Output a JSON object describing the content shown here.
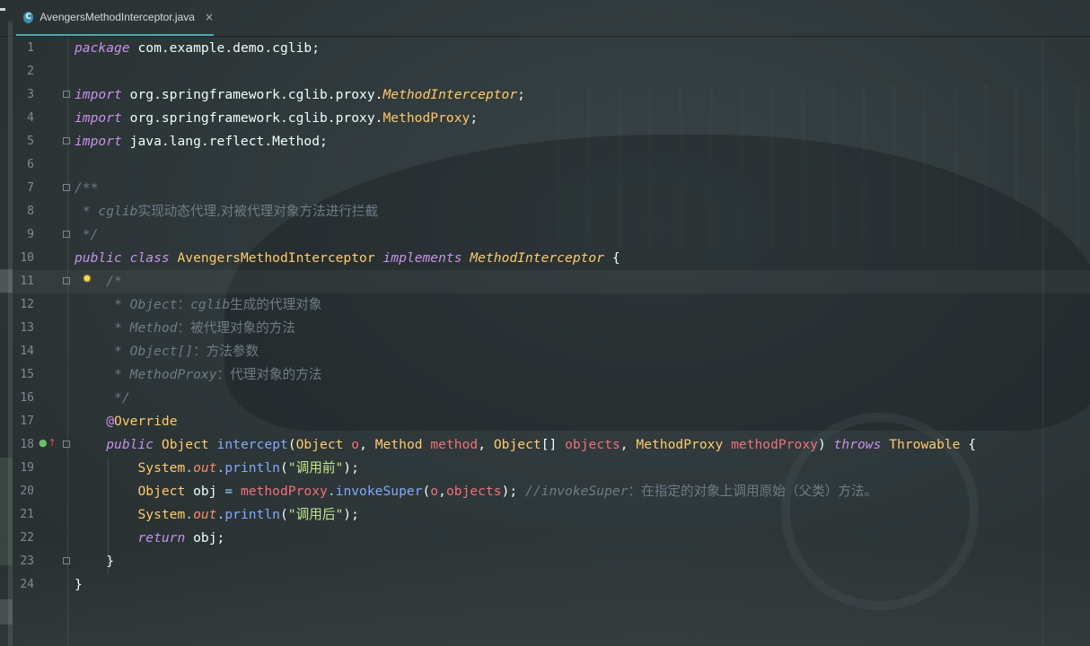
{
  "tab": {
    "icon_letter": "C",
    "filename": "AvengersMethodInterceptor.java",
    "close_glyph": "×"
  },
  "lines": [
    {
      "n": "1",
      "tokens": [
        [
          "kw",
          "package"
        ],
        [
          "txt",
          " com.example.demo.cglib;"
        ]
      ]
    },
    {
      "n": "2",
      "tokens": []
    },
    {
      "n": "3",
      "tokens": [
        [
          "kw",
          "import"
        ],
        [
          "txt",
          " org.springframework.cglib.proxy."
        ],
        [
          "cls-i",
          "MethodInterceptor"
        ],
        [
          "txt",
          ";"
        ]
      ]
    },
    {
      "n": "4",
      "tokens": [
        [
          "kw",
          "import"
        ],
        [
          "txt",
          " org.springframework.cglib.proxy."
        ],
        [
          "cls",
          "MethodProxy"
        ],
        [
          "txt",
          ";"
        ]
      ]
    },
    {
      "n": "5",
      "tokens": [
        [
          "kw",
          "import"
        ],
        [
          "txt",
          " java.lang.reflect.Method;"
        ]
      ]
    },
    {
      "n": "6",
      "tokens": []
    },
    {
      "n": "7",
      "tokens": [
        [
          "cmt",
          "/**"
        ]
      ]
    },
    {
      "n": "8",
      "tokens": [
        [
          "cmt",
          " * cglib"
        ],
        [
          "cmtz",
          "实现动态代理,对被代理对象方法进行拦截"
        ]
      ]
    },
    {
      "n": "9",
      "tokens": [
        [
          "cmt",
          " */"
        ]
      ]
    },
    {
      "n": "10",
      "tokens": [
        [
          "kw",
          "public"
        ],
        [
          "txt",
          " "
        ],
        [
          "kw",
          "class"
        ],
        [
          "txt",
          " "
        ],
        [
          "cls",
          "AvengersMethodInterceptor"
        ],
        [
          "txt",
          " "
        ],
        [
          "kw",
          "implements"
        ],
        [
          "txt",
          " "
        ],
        [
          "cls-i",
          "MethodInterceptor"
        ],
        [
          "txt",
          " {"
        ]
      ]
    },
    {
      "n": "11",
      "tokens": [
        [
          "txt",
          "    "
        ],
        [
          "cmt",
          "/*"
        ]
      ]
    },
    {
      "n": "12",
      "tokens": [
        [
          "cmt",
          "     * Object"
        ],
        [
          "cmtz",
          "："
        ],
        [
          "cmt",
          "cglib"
        ],
        [
          "cmtz",
          "生成的代理对象"
        ]
      ]
    },
    {
      "n": "13",
      "tokens": [
        [
          "cmt",
          "     * Method"
        ],
        [
          "cmtz",
          "：被代理对象的方法"
        ]
      ]
    },
    {
      "n": "14",
      "tokens": [
        [
          "cmt",
          "     * Object[]"
        ],
        [
          "cmtz",
          "：方法参数"
        ]
      ]
    },
    {
      "n": "15",
      "tokens": [
        [
          "cmt",
          "     * MethodProxy"
        ],
        [
          "cmtz",
          "：代理对象的方法"
        ]
      ]
    },
    {
      "n": "16",
      "tokens": [
        [
          "cmt",
          "     */"
        ]
      ]
    },
    {
      "n": "17",
      "tokens": [
        [
          "txt",
          "    "
        ],
        [
          "ann",
          "@"
        ],
        [
          "cls",
          "Override"
        ]
      ]
    },
    {
      "n": "18",
      "tokens": [
        [
          "txt",
          "    "
        ],
        [
          "kw",
          "public"
        ],
        [
          "txt",
          " "
        ],
        [
          "cls",
          "Object"
        ],
        [
          "txt",
          " "
        ],
        [
          "fn",
          "intercept"
        ],
        [
          "txt",
          "("
        ],
        [
          "cls",
          "Object"
        ],
        [
          "txt",
          " "
        ],
        [
          "par",
          "o"
        ],
        [
          "txt",
          ", "
        ],
        [
          "cls",
          "Method"
        ],
        [
          "txt",
          " "
        ],
        [
          "par",
          "method"
        ],
        [
          "txt",
          ", "
        ],
        [
          "cls",
          "Object"
        ],
        [
          "txt",
          "[] "
        ],
        [
          "par",
          "objects"
        ],
        [
          "txt",
          ", "
        ],
        [
          "cls",
          "MethodProxy"
        ],
        [
          "txt",
          " "
        ],
        [
          "par",
          "methodProxy"
        ],
        [
          "txt",
          ") "
        ],
        [
          "kw",
          "throws"
        ],
        [
          "txt",
          " "
        ],
        [
          "cls",
          "Throwable"
        ],
        [
          "txt",
          " {"
        ]
      ]
    },
    {
      "n": "19",
      "tokens": [
        [
          "txt",
          "        "
        ],
        [
          "cls",
          "System"
        ],
        [
          "pun",
          "."
        ],
        [
          "fld",
          "out"
        ],
        [
          "pun",
          "."
        ],
        [
          "fn",
          "println"
        ],
        [
          "txt",
          "("
        ],
        [
          "str",
          "\"调用前\""
        ],
        [
          "txt",
          ");"
        ]
      ]
    },
    {
      "n": "20",
      "tokens": [
        [
          "txt",
          "        "
        ],
        [
          "cls",
          "Object"
        ],
        [
          "txt",
          " obj "
        ],
        [
          "pun",
          "="
        ],
        [
          "txt",
          " "
        ],
        [
          "par",
          "methodProxy"
        ],
        [
          "pun",
          "."
        ],
        [
          "fn",
          "invokeSuper"
        ],
        [
          "txt",
          "("
        ],
        [
          "par",
          "o"
        ],
        [
          "txt",
          ","
        ],
        [
          "par",
          "objects"
        ],
        [
          "txt",
          "); "
        ],
        [
          "cmt",
          "//invokeSuper"
        ],
        [
          "cmtz",
          "：在指定的对象上调用原始（父类）方法。"
        ]
      ]
    },
    {
      "n": "21",
      "tokens": [
        [
          "txt",
          "        "
        ],
        [
          "cls",
          "System"
        ],
        [
          "pun",
          "."
        ],
        [
          "fld",
          "out"
        ],
        [
          "pun",
          "."
        ],
        [
          "fn",
          "println"
        ],
        [
          "txt",
          "("
        ],
        [
          "str",
          "\"调用后\""
        ],
        [
          "txt",
          ");"
        ]
      ]
    },
    {
      "n": "22",
      "tokens": [
        [
          "txt",
          "        "
        ],
        [
          "kw",
          "return"
        ],
        [
          "txt",
          " obj;"
        ]
      ]
    },
    {
      "n": "23",
      "tokens": [
        [
          "txt",
          "    }"
        ]
      ]
    },
    {
      "n": "24",
      "tokens": [
        [
          "txt",
          "}"
        ]
      ]
    }
  ],
  "current_line": "11",
  "fold_lines": [
    "3",
    "5",
    "7",
    "9",
    "11",
    "18",
    "23"
  ],
  "bulb_line": "11",
  "bulb_icon": "lightbulb-icon",
  "override_marker_line": "18",
  "override_marker_icon": "override-gutter-icon",
  "colors": {
    "keyword": "#c792ea",
    "class": "#ffcb6b",
    "function": "#82aaff",
    "string": "#c3e88d",
    "parameter": "#f07178",
    "field": "#f78c6c",
    "comment": "#6e7c87",
    "tab_underline": "#4fa6b2"
  }
}
